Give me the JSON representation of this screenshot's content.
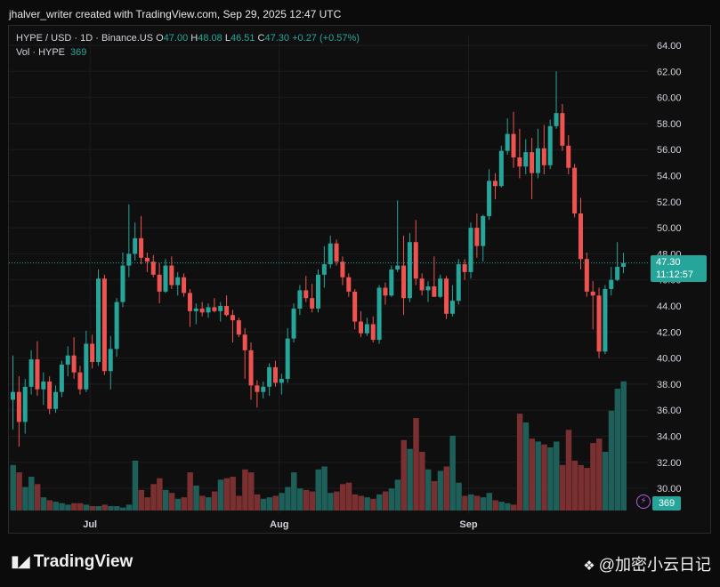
{
  "credit": "jhalver_writer created with TradingView.com, Sep 29, 2025 12:47 UTC",
  "legend": {
    "symbol": "HYPE / USD · 1D · Binance.US",
    "o_label": "O",
    "o": "47.00",
    "h_label": "H",
    "h": "48.08",
    "l_label": "L",
    "l": "46.51",
    "c_label": "C",
    "c": "47.30",
    "change": "+0.27 (+0.57%)",
    "vol_label": "Vol · HYPE",
    "vol_value": "369"
  },
  "price_tag": {
    "price": "47.30",
    "countdown": "11:12:57"
  },
  "vol_tag": "369",
  "footer": {
    "logo": "TradingView",
    "watermark": "@加密小云日记"
  },
  "colors": {
    "up": "#26a69a",
    "down": "#ef5350",
    "vol_up": "#1f5f5a",
    "vol_down": "#7a2f30"
  },
  "chart_data": {
    "type": "candlestick",
    "y_ticks": [
      "64.00",
      "62.00",
      "60.00",
      "58.00",
      "56.00",
      "54.00",
      "52.00",
      "50.00",
      "48.00",
      "46.00",
      "44.00",
      "42.00",
      "40.00",
      "38.00",
      "36.00",
      "34.00",
      "32.00",
      "30.00"
    ],
    "ylim": [
      29,
      65
    ],
    "x_ticks": [
      {
        "label": "Jul",
        "index": 13
      },
      {
        "label": "Aug",
        "index": 44
      },
      {
        "label": "Sep",
        "index": 75
      }
    ],
    "last_price": 47.3,
    "candles": [
      [
        36.8,
        40.2,
        34.5,
        37.4
      ],
      [
        37.4,
        38.6,
        33.2,
        35.1
      ],
      [
        35.1,
        38.4,
        34.2,
        37.8
      ],
      [
        37.8,
        40.6,
        37.2,
        39.9
      ],
      [
        39.9,
        41.3,
        37.1,
        37.6
      ],
      [
        37.6,
        38.9,
        36.4,
        38.2
      ],
      [
        38.2,
        38.6,
        35.7,
        36.1
      ],
      [
        36.1,
        37.9,
        35.8,
        37.4
      ],
      [
        37.4,
        39.8,
        37.0,
        39.5
      ],
      [
        39.5,
        40.9,
        38.6,
        40.2
      ],
      [
        40.2,
        41.6,
        38.4,
        38.9
      ],
      [
        38.9,
        39.4,
        37.2,
        37.6
      ],
      [
        37.6,
        42.1,
        37.4,
        41.1
      ],
      [
        41.1,
        41.8,
        39.2,
        39.7
      ],
      [
        39.7,
        46.8,
        39.4,
        46.1
      ],
      [
        46.1,
        46.4,
        38.7,
        39.0
      ],
      [
        39.0,
        41.7,
        37.6,
        40.7
      ],
      [
        40.7,
        44.6,
        40.1,
        44.3
      ],
      [
        44.3,
        48.1,
        43.9,
        47.1
      ],
      [
        47.1,
        51.8,
        46.2,
        48.0
      ],
      [
        48.0,
        50.4,
        47.5,
        49.2
      ],
      [
        49.2,
        50.9,
        47.2,
        47.7
      ],
      [
        47.7,
        48.1,
        46.6,
        47.4
      ],
      [
        47.4,
        47.9,
        46.2,
        46.4
      ],
      [
        46.4,
        47.3,
        44.2,
        45.1
      ],
      [
        45.1,
        47.6,
        45.0,
        47.1
      ],
      [
        47.1,
        47.8,
        45.3,
        45.6
      ],
      [
        45.6,
        46.6,
        44.8,
        46.2
      ],
      [
        46.2,
        46.5,
        44.7,
        45.0
      ],
      [
        45.0,
        45.3,
        42.4,
        43.6
      ],
      [
        43.6,
        44.2,
        42.6,
        43.8
      ],
      [
        43.8,
        44.3,
        43.2,
        43.5
      ],
      [
        43.5,
        44.2,
        43.1,
        43.9
      ],
      [
        43.9,
        44.6,
        43.5,
        43.6
      ],
      [
        43.6,
        44.3,
        42.8,
        44.0
      ],
      [
        44.0,
        44.8,
        43.2,
        43.3
      ],
      [
        43.3,
        43.7,
        41.2,
        42.9
      ],
      [
        42.9,
        43.1,
        41.6,
        41.8
      ],
      [
        41.8,
        42.3,
        38.4,
        40.6
      ],
      [
        40.6,
        41.2,
        36.8,
        37.9
      ],
      [
        37.9,
        38.3,
        36.2,
        37.4
      ],
      [
        37.4,
        38.2,
        36.9,
        37.8
      ],
      [
        37.8,
        39.6,
        37.1,
        39.3
      ],
      [
        39.3,
        39.8,
        37.8,
        38.1
      ],
      [
        38.1,
        38.8,
        37.2,
        38.4
      ],
      [
        38.4,
        42.3,
        38.1,
        41.5
      ],
      [
        41.5,
        44.2,
        41.2,
        43.8
      ],
      [
        43.8,
        45.6,
        43.3,
        45.2
      ],
      [
        45.2,
        46.3,
        44.3,
        44.6
      ],
      [
        44.6,
        45.7,
        43.5,
        43.8
      ],
      [
        43.8,
        46.8,
        43.5,
        46.4
      ],
      [
        46.4,
        48.6,
        45.4,
        47.2
      ],
      [
        47.2,
        49.4,
        46.9,
        48.8
      ],
      [
        48.8,
        49.1,
        47.1,
        47.4
      ],
      [
        47.4,
        47.8,
        45.6,
        46.2
      ],
      [
        46.2,
        46.5,
        44.7,
        45.1
      ],
      [
        45.1,
        45.3,
        42.2,
        42.8
      ],
      [
        42.8,
        43.6,
        41.6,
        41.9
      ],
      [
        41.9,
        43.1,
        41.7,
        42.6
      ],
      [
        42.6,
        43.2,
        41.2,
        41.4
      ],
      [
        41.4,
        45.6,
        41.1,
        45.4
      ],
      [
        45.4,
        45.8,
        44.1,
        44.8
      ],
      [
        44.8,
        47.1,
        44.7,
        46.8
      ],
      [
        46.8,
        52.1,
        46.6,
        47.1
      ],
      [
        47.1,
        49.4,
        43.3,
        44.6
      ],
      [
        44.6,
        49.6,
        44.3,
        48.9
      ],
      [
        48.9,
        50.6,
        45.6,
        46.1
      ],
      [
        46.1,
        46.5,
        44.8,
        45.2
      ],
      [
        45.2,
        45.9,
        44.3,
        45.5
      ],
      [
        45.5,
        47.8,
        44.9,
        44.7
      ],
      [
        44.7,
        46.4,
        44.6,
        46.1
      ],
      [
        46.1,
        46.3,
        43.0,
        43.4
      ],
      [
        43.4,
        45.6,
        43.2,
        44.4
      ],
      [
        44.4,
        47.6,
        44.1,
        47.2
      ],
      [
        47.2,
        47.6,
        46.0,
        46.6
      ],
      [
        46.6,
        50.4,
        46.1,
        50.0
      ],
      [
        50.0,
        51.1,
        47.7,
        48.6
      ],
      [
        48.6,
        51.0,
        47.4,
        50.9
      ],
      [
        50.9,
        54.5,
        50.6,
        53.6
      ],
      [
        53.6,
        54.2,
        52.2,
        53.2
      ],
      [
        53.2,
        56.3,
        53.1,
        55.9
      ],
      [
        55.9,
        58.4,
        55.6,
        57.2
      ],
      [
        57.2,
        58.9,
        54.6,
        55.4
      ],
      [
        55.4,
        57.6,
        53.8,
        54.7
      ],
      [
        54.7,
        56.8,
        54.1,
        55.8
      ],
      [
        55.8,
        56.9,
        52.2,
        54.2
      ],
      [
        54.2,
        57.6,
        53.8,
        56.1
      ],
      [
        56.1,
        57.9,
        54.1,
        54.8
      ],
      [
        54.8,
        58.3,
        54.5,
        57.8
      ],
      [
        57.8,
        62.0,
        57.6,
        58.8
      ],
      [
        58.8,
        59.5,
        55.9,
        56.3
      ],
      [
        56.3,
        57.1,
        54.1,
        54.6
      ],
      [
        54.6,
        54.9,
        50.8,
        51.1
      ],
      [
        51.1,
        52.3,
        46.8,
        47.6
      ],
      [
        47.6,
        48.1,
        44.7,
        45.1
      ],
      [
        45.1,
        45.9,
        42.2,
        44.8
      ],
      [
        44.8,
        45.4,
        40.0,
        40.5
      ],
      [
        40.5,
        45.6,
        40.3,
        45.3
      ],
      [
        45.3,
        47.0,
        44.8,
        46.0
      ],
      [
        46.0,
        48.9,
        45.9,
        47.0
      ],
      [
        47.0,
        48.08,
        46.51,
        47.3
      ]
    ],
    "volume": [
      3.1,
      2.6,
      1.6,
      2.3,
      1.8,
      0.9,
      0.7,
      0.6,
      0.5,
      0.4,
      0.5,
      0.5,
      0.4,
      0.3,
      0.3,
      0.4,
      0.3,
      0.3,
      0.2,
      0.4,
      3.4,
      1.4,
      0.9,
      1.8,
      2.2,
      1.4,
      1.2,
      0.8,
      0.9,
      2.6,
      1.7,
      1.0,
      0.9,
      1.3,
      2.1,
      2.2,
      2.3,
      1.0,
      2.8,
      2.6,
      1.1,
      0.8,
      0.9,
      1.0,
      1.2,
      1.6,
      2.6,
      1.5,
      1.4,
      1.3,
      2.8,
      3.0,
      1.2,
      1.3,
      1.8,
      1.9,
      1.1,
      1.0,
      0.9,
      0.8,
      1.1,
      1.3,
      1.5,
      2.1,
      4.8,
      4.2,
      6.3,
      4.0,
      2.8,
      2.0,
      2.7,
      3.0,
      5.1,
      1.9,
      1.0,
      1.1,
      1.0,
      0.9,
      1.2,
      0.7,
      0.6,
      0.5,
      0.4,
      6.6,
      6.0,
      4.9,
      4.7,
      4.5,
      4.3,
      4.7,
      3.1,
      5.5,
      3.4,
      3.1,
      2.9,
      4.6,
      4.9,
      4.0,
      6.8,
      8.3,
      8.8,
      3.5,
      1.0
    ]
  }
}
